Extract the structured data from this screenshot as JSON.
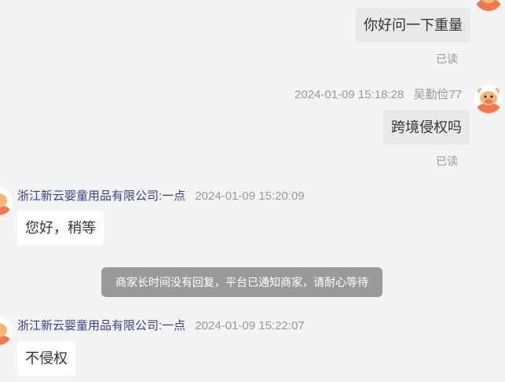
{
  "messages": [
    {
      "direction": "out",
      "text": "你好问一下重量",
      "read_status": "已读"
    },
    {
      "direction": "out",
      "time": "2024-01-09 15:18:28",
      "sender": "吴勤俭77",
      "text": "跨境侵权吗",
      "read_status": "已读"
    },
    {
      "direction": "in",
      "sender": "浙江新云婴童用品有限公司:一点",
      "time": "2024-01-09 15:20:09",
      "text": "您好，稍等"
    },
    {
      "direction": "in",
      "sender": "浙江新云婴童用品有限公司:一点",
      "time": "2024-01-09 15:22:07",
      "text": "不侵权"
    }
  ],
  "system_notice": "商家长时间没有回复，平台已通知商家，请耐心等待",
  "colors": {
    "background": "#f4f4f4",
    "outgoing_bubble": "#e9e9e9",
    "incoming_bubble": "#ffffff",
    "shop_name": "#3a3f8f",
    "meta_text": "#999999",
    "notice_bg": "#9a9a9a",
    "avatar_orange": "#f07850"
  },
  "icons": {
    "user_avatar": "cartoon-bull-avatar-icon",
    "shop_avatar": "shop-avatar-icon"
  }
}
